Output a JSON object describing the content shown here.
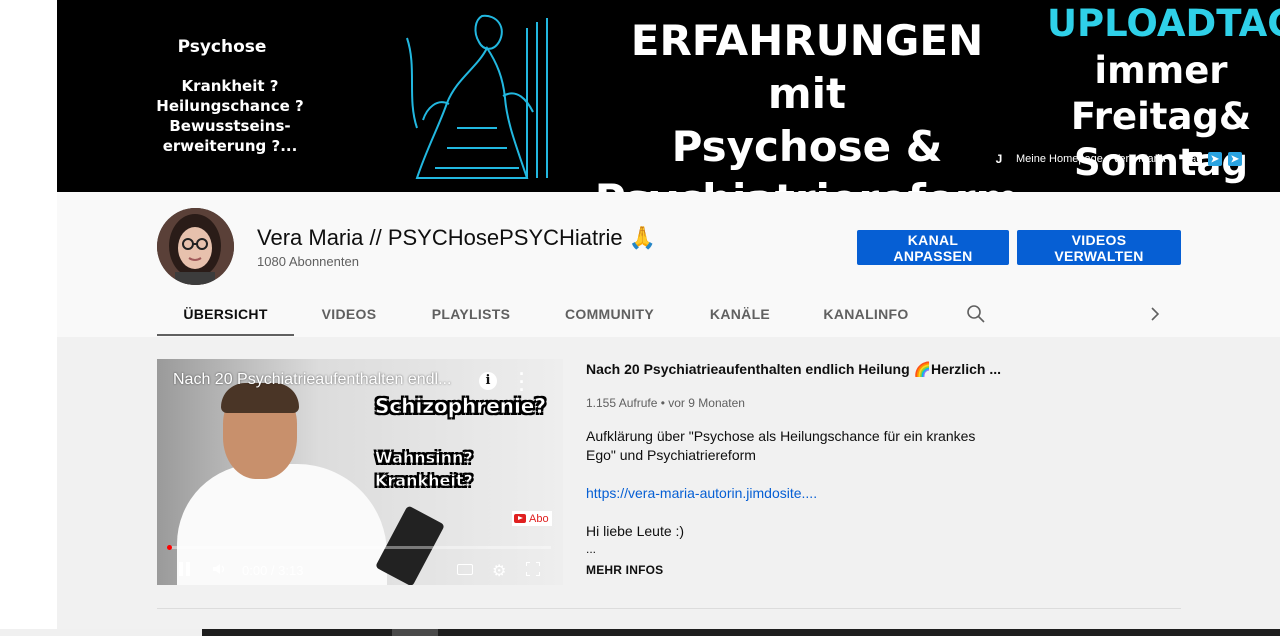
{
  "banner": {
    "left_heading": "Psychose",
    "left_lines": [
      "Krankheit ?",
      "Heilungschance ?",
      "Bewusstseins-",
      "erweiterung ?..."
    ],
    "title_lines": [
      "ERFAHRUNGEN mit",
      "Psychose &",
      "Psychiatriereform"
    ],
    "upload_heading": "UPLOADTAG",
    "upload_lines": [
      "immer",
      "Freitag&",
      "Sonntag"
    ],
    "link_text": "Meine Homepage - Vera Maria",
    "icons": [
      "jimdo-icon",
      "amazon-icon",
      "telegram-icon",
      "telegram-icon"
    ]
  },
  "channel": {
    "name": "Vera Maria // PSYCHosePSYCHiatrie 🙏",
    "subscribers": "1080 Abonnenten",
    "customize_label": "KANAL ANPASSEN",
    "manage_label": "VIDEOS VERWALTEN"
  },
  "tabs": [
    "ÜBERSICHT",
    "VIDEOS",
    "PLAYLISTS",
    "COMMUNITY",
    "KANÄLE",
    "KANALINFO"
  ],
  "featured": {
    "overlay_title": "Nach 20 Psychiatrieaufenthalten endl...",
    "overlay_texts": [
      "Schizophrenie?",
      "Wahnsinn?",
      "Krankheit?"
    ],
    "subscribe_label": "Abo",
    "time": "0:00 / 3:13",
    "title": "Nach 20 Psychiatrieaufenthalten endlich Heilung 🌈Herzlich ...",
    "meta": "1.155 Aufrufe • vor 9 Monaten",
    "description": "Aufklärung  über \"Psychose als Heilungschance für ein krankes Ego\" und Psychiatriereform",
    "link": "https://vera-maria-autorin.jimdosite....",
    "greeting": "Hi liebe Leute :)",
    "ellipsis": "...",
    "more_label": "MEHR INFOS"
  },
  "colors": {
    "accent_blue": "#065fd4",
    "banner_cyan": "#2fd0e8",
    "progress_red": "#ff0000"
  }
}
